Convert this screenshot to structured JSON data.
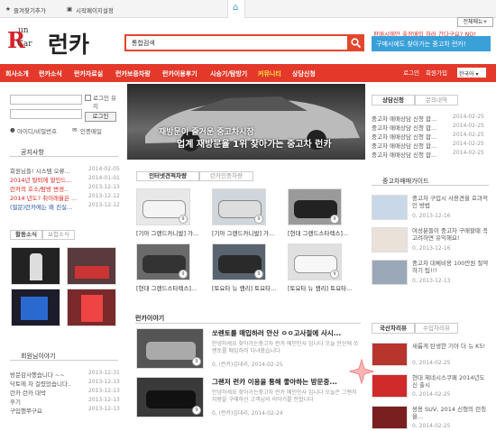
{
  "topbar": {
    "bookmark": "즐겨찾기추가",
    "homepage": "시작페이지설정",
    "shortcut": "전체메뉴+"
  },
  "logo": {
    "run": "un",
    "car": "Car",
    "ko": "런카"
  },
  "search": {
    "placeholder": "통합검색"
  },
  "ad": {
    "line1": "판매시에만 출장매입 하러 간다구요? NO!",
    "line2": "구매시에도 찾아가는 중고차 런카!"
  },
  "nav": {
    "items": [
      "회사소개",
      "런카소식",
      "런카자료실",
      "런카보증차량",
      "런카이용후기",
      "시승기/탐방기",
      "커뮤니티",
      "상담신청"
    ],
    "login": "로그인",
    "join": "회원가입",
    "lang": "한국어"
  },
  "login": {
    "save_label": "로그인 유지",
    "submit": "로그인",
    "find": "아이디/비밀번호",
    "cert": "인증메일"
  },
  "notice": {
    "title": "공지사항",
    "items": [
      {
        "t": "회원님들! 시스템 오류...",
        "d": "2014-02-05",
        "red": false
      },
      {
        "t": "2014년 탈퇴에 할인드...",
        "d": "2014-01-01",
        "red": true
      },
      {
        "t": "런카의 호소/탐방 변경..",
        "d": "2013-12-13",
        "red": true
      },
      {
        "t": "2014 년도? 취이래율은 ...",
        "d": "2013-12-12",
        "red": true
      },
      {
        "t": "(필문)런카에는 왜 진실...",
        "d": "2013-12-12",
        "red": false
      }
    ]
  },
  "activity": {
    "tab1": "활동소식",
    "tab2": "보험소식"
  },
  "member": {
    "title": "회원님이야기",
    "items": [
      {
        "t": "방문감사했습니다 ~~",
        "d": "2013-12-31"
      },
      {
        "t": "닥토에 차 걸렸었습니다..",
        "d": "2013-12-13"
      },
      {
        "t": "런카 런카 대박",
        "d": "2013-12-13"
      },
      {
        "t": "후기",
        "d": "2013-12-13"
      },
      {
        "t": "구입했쭈구요",
        "d": "2013-12-13"
      }
    ]
  },
  "banner": {
    "line1": "재방문이 즐거운 중고차시장",
    "line2": "업계 재방문율 1위 찾아가는 중고차 런카"
  },
  "cars": {
    "tab1": "인터넷견적차량",
    "tab2": "런카인증차량",
    "row1": [
      "[기아 그랜드카니발] 가...",
      "[기아 그랜드카니발] 가...",
      "[현대 그랜드스타렉스]..."
    ],
    "row2": [
      "[현대 그랜드스타렉스]...",
      "[토요타 뉴 캠리] 토요타...",
      "[토요타 뉴 캠리] 토요타..."
    ]
  },
  "story": {
    "title": "런카이야기",
    "items": [
      {
        "h": "쏘렌토를 매입하러 안산 ㅇㅇ고사절에 사시...",
        "s": "안녕하세요 찾아가는중고차 런카 메인인사 입니다 오늘 안산에 쏘렌토를 매입하러 다녀왔습니다",
        "m": "0, (런카)김대리, 2014-02-25"
      },
      {
        "h": "그랜저 런카 이용을 통해 좋아하는 방문중...",
        "s": "안녕하세요 찾아가는중고차 런카 메인인사 입니다 오늘은 그랜저 차량을 구매하신 고객님의 이야기를 전합니다",
        "m": "0, (런카)김대리, 2014-02-24"
      }
    ]
  },
  "consult": {
    "tab1": "상담신청",
    "tab2": "문의내역",
    "items": [
      {
        "t": "중고차 매매상담 신청 합...",
        "d": "2014-02-25"
      },
      {
        "t": "중고차 매매상담 신청 합...",
        "d": "2014-02-25"
      },
      {
        "t": "중고차 매매상담 신청 합...",
        "d": "2014-02-25"
      },
      {
        "t": "중고차 매매상담 신청 합...",
        "d": "2014-02-25"
      },
      {
        "t": "중고차 매매상담 신청 합...",
        "d": "2014-02-25"
      }
    ]
  },
  "guide": {
    "title": "중고차매매가이드",
    "items": [
      {
        "t": "중고차 구입시 사용견을 효과적인 방법",
        "m": "0, 2013-12-16"
      },
      {
        "t": "여성분들이 중고차 구매할때 꼭 고려하면 유익해요!",
        "m": "0, 2013-12-16"
      },
      {
        "t": "중고차 대체비용 100만원 절약하기 팁!!!",
        "m": "0, 2013-12-13"
      }
    ]
  },
  "news": {
    "tab1": "국산차리뷰",
    "tab2": "수입차리뷰",
    "items": [
      {
        "t": "새롭게 탄생한 기아 더 뉴 K5!",
        "m": "0, 2014-02-25"
      },
      {
        "t": "현대 제네시스쿠페 2014년도 신 출시",
        "m": "0, 2014-02-25"
      },
      {
        "t": "쌍용 SUV, 2014 신형의 런칭을...",
        "m": "0, 2014-02-25"
      }
    ]
  },
  "colors": {
    "accent": "#e4392a",
    "blue": "#3aa0d8"
  }
}
